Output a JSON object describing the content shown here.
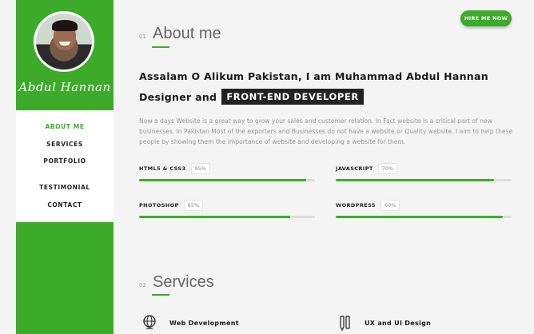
{
  "sidebar": {
    "signature": "Abdul Hannan",
    "nav": [
      {
        "label": "ABOUT ME",
        "active": true
      },
      {
        "label": "SERVICES",
        "active": false
      },
      {
        "label": "PORTFOLIO",
        "active": false
      },
      {
        "label": "TESTIMONIAL",
        "active": false
      },
      {
        "label": "CONTACT",
        "active": false
      }
    ]
  },
  "header": {
    "hire_label": "HIRE ME NOW"
  },
  "about": {
    "number": "01",
    "title": "About me",
    "greeting": "Assalam O Alikum Pakistan, I am Muhammad Abdul Hannan",
    "role_prefix": "Designer and",
    "role_badge": "FRONT-END DEVELOPER",
    "description": "Now a days Website is a great way to grow your sales and customer relation. In Fact website is a critical part of new businesses. In Pakistan Most of the exporters and Businesses do not have a website or Quality website. I aim to help these people by showing them the importance of website and developing a website for them.",
    "skills": [
      {
        "name": "HTML5 & CSS3",
        "percent_label": "95%",
        "level": 0.95
      },
      {
        "name": "JAVASCRIPT",
        "percent_label": "70%",
        "level": 0.9
      },
      {
        "name": "PHOTOSHOP",
        "percent_label": "65%",
        "level": 0.86
      },
      {
        "name": "WORDPRESS",
        "percent_label": "60%",
        "level": 0.95
      }
    ]
  },
  "services": {
    "number": "02",
    "title": "Services",
    "items": [
      {
        "label": "Web Development",
        "icon": "globe-icon"
      },
      {
        "label": "UX and UI Design",
        "icon": "design-tools-icon"
      }
    ]
  },
  "colors": {
    "accent": "#3cab2a",
    "badge": "#222222"
  }
}
